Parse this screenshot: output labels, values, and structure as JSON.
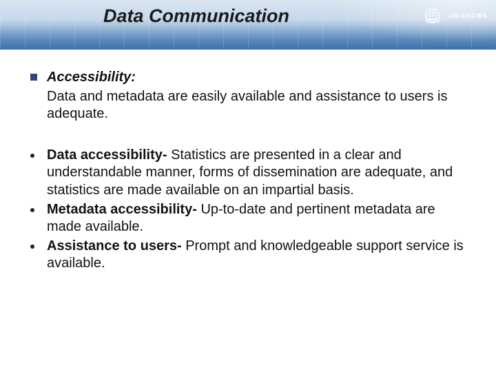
{
  "header": {
    "title": "Data Communication",
    "org_acronym": "UN-ESCWA"
  },
  "intro": {
    "heading": "Accessibility:",
    "text": "Data and metadata are easily available and assistance to users is adequate."
  },
  "points": [
    {
      "term": "Data accessibility- ",
      "desc": "Statistics are presented in a clear and understandable manner, forms of dissemination are adequate, and statistics are made available on an impartial basis."
    },
    {
      "term": "Metadata accessibility- ",
      "desc": "Up-to-date and pertinent metadata are made available."
    },
    {
      "term": "Assistance to users- ",
      "desc": "Prompt and knowledgeable support service is available."
    }
  ]
}
